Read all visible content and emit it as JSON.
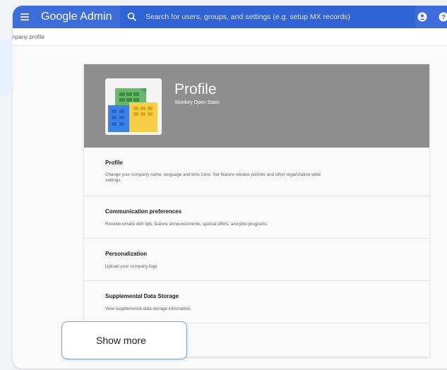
{
  "app": {
    "title": "Google Admin"
  },
  "search": {
    "placeholder": "Search for users, groups, and settings (e.g. setup MX records)"
  },
  "breadcrumb": {
    "label": "Company profile"
  },
  "card": {
    "title": "Profile",
    "org_name": "Monkey Open Static",
    "sections": [
      {
        "title": "Profile",
        "description": "Change your company name, language and time zone. Set feature release policies and other organization-wide settings."
      },
      {
        "title": "Communication preferences",
        "description": "Receive emails with tips, feature announcements, special offers, and pilot programs."
      },
      {
        "title": "Personalization",
        "description": "Upload your company logo"
      },
      {
        "title": "Supplemental Data Storage",
        "description": "View supplemental data storage information."
      }
    ]
  },
  "show_more": {
    "label": "Show more"
  },
  "icons": {
    "menu": "menu-icon",
    "search": "search-icon",
    "account": "account-icon",
    "help": "help-icon",
    "logo": "building-logo-icon"
  },
  "colors": {
    "topbar": "#3c6ddb",
    "search_bg": "#2f63d6",
    "card_header": "#8e8e8e",
    "show_more_border": "#6a9ef8"
  }
}
